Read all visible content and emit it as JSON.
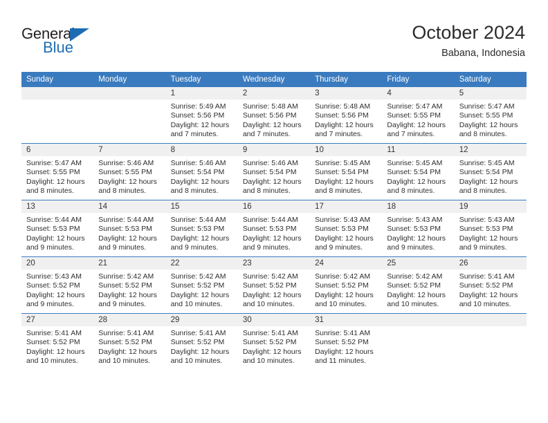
{
  "brand": {
    "name_part1": "General",
    "name_part2": "Blue",
    "primary_color": "#1d6cb3"
  },
  "header": {
    "month_title": "October 2024",
    "location": "Babana, Indonesia"
  },
  "calendar": {
    "header_color": "#3a7bbf",
    "weekday_headers": [
      "Sunday",
      "Monday",
      "Tuesday",
      "Wednesday",
      "Thursday",
      "Friday",
      "Saturday"
    ],
    "weeks": [
      [
        {
          "day": "",
          "lines": []
        },
        {
          "day": "",
          "lines": []
        },
        {
          "day": "1",
          "lines": [
            "Sunrise: 5:49 AM",
            "Sunset: 5:56 PM",
            "Daylight: 12 hours",
            "and 7 minutes."
          ]
        },
        {
          "day": "2",
          "lines": [
            "Sunrise: 5:48 AM",
            "Sunset: 5:56 PM",
            "Daylight: 12 hours",
            "and 7 minutes."
          ]
        },
        {
          "day": "3",
          "lines": [
            "Sunrise: 5:48 AM",
            "Sunset: 5:56 PM",
            "Daylight: 12 hours",
            "and 7 minutes."
          ]
        },
        {
          "day": "4",
          "lines": [
            "Sunrise: 5:47 AM",
            "Sunset: 5:55 PM",
            "Daylight: 12 hours",
            "and 7 minutes."
          ]
        },
        {
          "day": "5",
          "lines": [
            "Sunrise: 5:47 AM",
            "Sunset: 5:55 PM",
            "Daylight: 12 hours",
            "and 8 minutes."
          ]
        }
      ],
      [
        {
          "day": "6",
          "lines": [
            "Sunrise: 5:47 AM",
            "Sunset: 5:55 PM",
            "Daylight: 12 hours",
            "and 8 minutes."
          ]
        },
        {
          "day": "7",
          "lines": [
            "Sunrise: 5:46 AM",
            "Sunset: 5:55 PM",
            "Daylight: 12 hours",
            "and 8 minutes."
          ]
        },
        {
          "day": "8",
          "lines": [
            "Sunrise: 5:46 AM",
            "Sunset: 5:54 PM",
            "Daylight: 12 hours",
            "and 8 minutes."
          ]
        },
        {
          "day": "9",
          "lines": [
            "Sunrise: 5:46 AM",
            "Sunset: 5:54 PM",
            "Daylight: 12 hours",
            "and 8 minutes."
          ]
        },
        {
          "day": "10",
          "lines": [
            "Sunrise: 5:45 AM",
            "Sunset: 5:54 PM",
            "Daylight: 12 hours",
            "and 8 minutes."
          ]
        },
        {
          "day": "11",
          "lines": [
            "Sunrise: 5:45 AM",
            "Sunset: 5:54 PM",
            "Daylight: 12 hours",
            "and 8 minutes."
          ]
        },
        {
          "day": "12",
          "lines": [
            "Sunrise: 5:45 AM",
            "Sunset: 5:54 PM",
            "Daylight: 12 hours",
            "and 8 minutes."
          ]
        }
      ],
      [
        {
          "day": "13",
          "lines": [
            "Sunrise: 5:44 AM",
            "Sunset: 5:53 PM",
            "Daylight: 12 hours",
            "and 9 minutes."
          ]
        },
        {
          "day": "14",
          "lines": [
            "Sunrise: 5:44 AM",
            "Sunset: 5:53 PM",
            "Daylight: 12 hours",
            "and 9 minutes."
          ]
        },
        {
          "day": "15",
          "lines": [
            "Sunrise: 5:44 AM",
            "Sunset: 5:53 PM",
            "Daylight: 12 hours",
            "and 9 minutes."
          ]
        },
        {
          "day": "16",
          "lines": [
            "Sunrise: 5:44 AM",
            "Sunset: 5:53 PM",
            "Daylight: 12 hours",
            "and 9 minutes."
          ]
        },
        {
          "day": "17",
          "lines": [
            "Sunrise: 5:43 AM",
            "Sunset: 5:53 PM",
            "Daylight: 12 hours",
            "and 9 minutes."
          ]
        },
        {
          "day": "18",
          "lines": [
            "Sunrise: 5:43 AM",
            "Sunset: 5:53 PM",
            "Daylight: 12 hours",
            "and 9 minutes."
          ]
        },
        {
          "day": "19",
          "lines": [
            "Sunrise: 5:43 AM",
            "Sunset: 5:53 PM",
            "Daylight: 12 hours",
            "and 9 minutes."
          ]
        }
      ],
      [
        {
          "day": "20",
          "lines": [
            "Sunrise: 5:43 AM",
            "Sunset: 5:52 PM",
            "Daylight: 12 hours",
            "and 9 minutes."
          ]
        },
        {
          "day": "21",
          "lines": [
            "Sunrise: 5:42 AM",
            "Sunset: 5:52 PM",
            "Daylight: 12 hours",
            "and 9 minutes."
          ]
        },
        {
          "day": "22",
          "lines": [
            "Sunrise: 5:42 AM",
            "Sunset: 5:52 PM",
            "Daylight: 12 hours",
            "and 10 minutes."
          ]
        },
        {
          "day": "23",
          "lines": [
            "Sunrise: 5:42 AM",
            "Sunset: 5:52 PM",
            "Daylight: 12 hours",
            "and 10 minutes."
          ]
        },
        {
          "day": "24",
          "lines": [
            "Sunrise: 5:42 AM",
            "Sunset: 5:52 PM",
            "Daylight: 12 hours",
            "and 10 minutes."
          ]
        },
        {
          "day": "25",
          "lines": [
            "Sunrise: 5:42 AM",
            "Sunset: 5:52 PM",
            "Daylight: 12 hours",
            "and 10 minutes."
          ]
        },
        {
          "day": "26",
          "lines": [
            "Sunrise: 5:41 AM",
            "Sunset: 5:52 PM",
            "Daylight: 12 hours",
            "and 10 minutes."
          ]
        }
      ],
      [
        {
          "day": "27",
          "lines": [
            "Sunrise: 5:41 AM",
            "Sunset: 5:52 PM",
            "Daylight: 12 hours",
            "and 10 minutes."
          ]
        },
        {
          "day": "28",
          "lines": [
            "Sunrise: 5:41 AM",
            "Sunset: 5:52 PM",
            "Daylight: 12 hours",
            "and 10 minutes."
          ]
        },
        {
          "day": "29",
          "lines": [
            "Sunrise: 5:41 AM",
            "Sunset: 5:52 PM",
            "Daylight: 12 hours",
            "and 10 minutes."
          ]
        },
        {
          "day": "30",
          "lines": [
            "Sunrise: 5:41 AM",
            "Sunset: 5:52 PM",
            "Daylight: 12 hours",
            "and 10 minutes."
          ]
        },
        {
          "day": "31",
          "lines": [
            "Sunrise: 5:41 AM",
            "Sunset: 5:52 PM",
            "Daylight: 12 hours",
            "and 11 minutes."
          ]
        },
        {
          "day": "",
          "lines": []
        },
        {
          "day": "",
          "lines": []
        }
      ]
    ]
  }
}
